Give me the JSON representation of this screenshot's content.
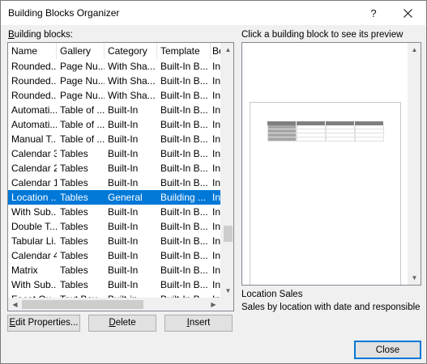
{
  "window": {
    "title": "Building Blocks Organizer",
    "help_symbol": "?"
  },
  "list": {
    "label_prefix": "B",
    "label_rest": "uilding blocks:",
    "columns": [
      "Name",
      "Gallery",
      "Category",
      "Template",
      "Be"
    ],
    "rows": [
      {
        "name": "Rounded...",
        "gallery": "Page Nu...",
        "category": "With Sha...",
        "template": "Built-In B...",
        "behavior": "In"
      },
      {
        "name": "Rounded...",
        "gallery": "Page Nu...",
        "category": "With Sha...",
        "template": "Built-In B...",
        "behavior": "In"
      },
      {
        "name": "Rounded...",
        "gallery": "Page Nu...",
        "category": "With Sha...",
        "template": "Built-In B...",
        "behavior": "In"
      },
      {
        "name": "Automati...",
        "gallery": "Table of ...",
        "category": "Built-In",
        "template": "Built-In B...",
        "behavior": "In"
      },
      {
        "name": "Automati...",
        "gallery": "Table of ...",
        "category": "Built-In",
        "template": "Built-In B...",
        "behavior": "In"
      },
      {
        "name": "Manual T...",
        "gallery": "Table of ...",
        "category": "Built-In",
        "template": "Built-In B...",
        "behavior": "In"
      },
      {
        "name": "Calendar 3",
        "gallery": "Tables",
        "category": "Built-In",
        "template": "Built-In B...",
        "behavior": "In"
      },
      {
        "name": "Calendar 2",
        "gallery": "Tables",
        "category": "Built-In",
        "template": "Built-In B...",
        "behavior": "In"
      },
      {
        "name": "Calendar 1",
        "gallery": "Tables",
        "category": "Built-In",
        "template": "Built-In B...",
        "behavior": "In"
      },
      {
        "name": "Location ...",
        "gallery": "Tables",
        "category": "General",
        "template": "Building ...",
        "behavior": "In",
        "selected": true
      },
      {
        "name": "With Sub...",
        "gallery": "Tables",
        "category": "Built-In",
        "template": "Built-In B...",
        "behavior": "In"
      },
      {
        "name": "Double T...",
        "gallery": "Tables",
        "category": "Built-In",
        "template": "Built-In B...",
        "behavior": "In"
      },
      {
        "name": "Tabular Li...",
        "gallery": "Tables",
        "category": "Built-In",
        "template": "Built-In B...",
        "behavior": "In"
      },
      {
        "name": "Calendar 4",
        "gallery": "Tables",
        "category": "Built-In",
        "template": "Built-In B...",
        "behavior": "In"
      },
      {
        "name": "Matrix",
        "gallery": "Tables",
        "category": "Built-In",
        "template": "Built-In B...",
        "behavior": "In"
      },
      {
        "name": "With Sub...",
        "gallery": "Tables",
        "category": "Built-In",
        "template": "Built-In B...",
        "behavior": "In"
      },
      {
        "name": "Facet Ou...",
        "gallery": "Text Box...",
        "category": "Built-in",
        "template": "Built-In B...",
        "behavior": "In"
      }
    ],
    "vertical_scroll_position": 0.72
  },
  "preview": {
    "label": "Click a building block to see its preview",
    "block_name": "Location Sales",
    "block_description": "Sales by location with date and responsible"
  },
  "buttons": {
    "edit_accel": "E",
    "edit_rest": "dit Properties...",
    "delete_accel": "D",
    "delete_rest": "elete",
    "insert_accel": "I",
    "insert_rest": "nsert",
    "close": "Close"
  },
  "icons": {
    "close": "close-icon",
    "scroll_up": "arrow-up-icon",
    "scroll_down": "arrow-down-icon",
    "scroll_left": "arrow-left-icon",
    "scroll_right": "arrow-right-icon"
  },
  "colors": {
    "selection": "#0078d7",
    "default_button_border": "#0078d7"
  }
}
